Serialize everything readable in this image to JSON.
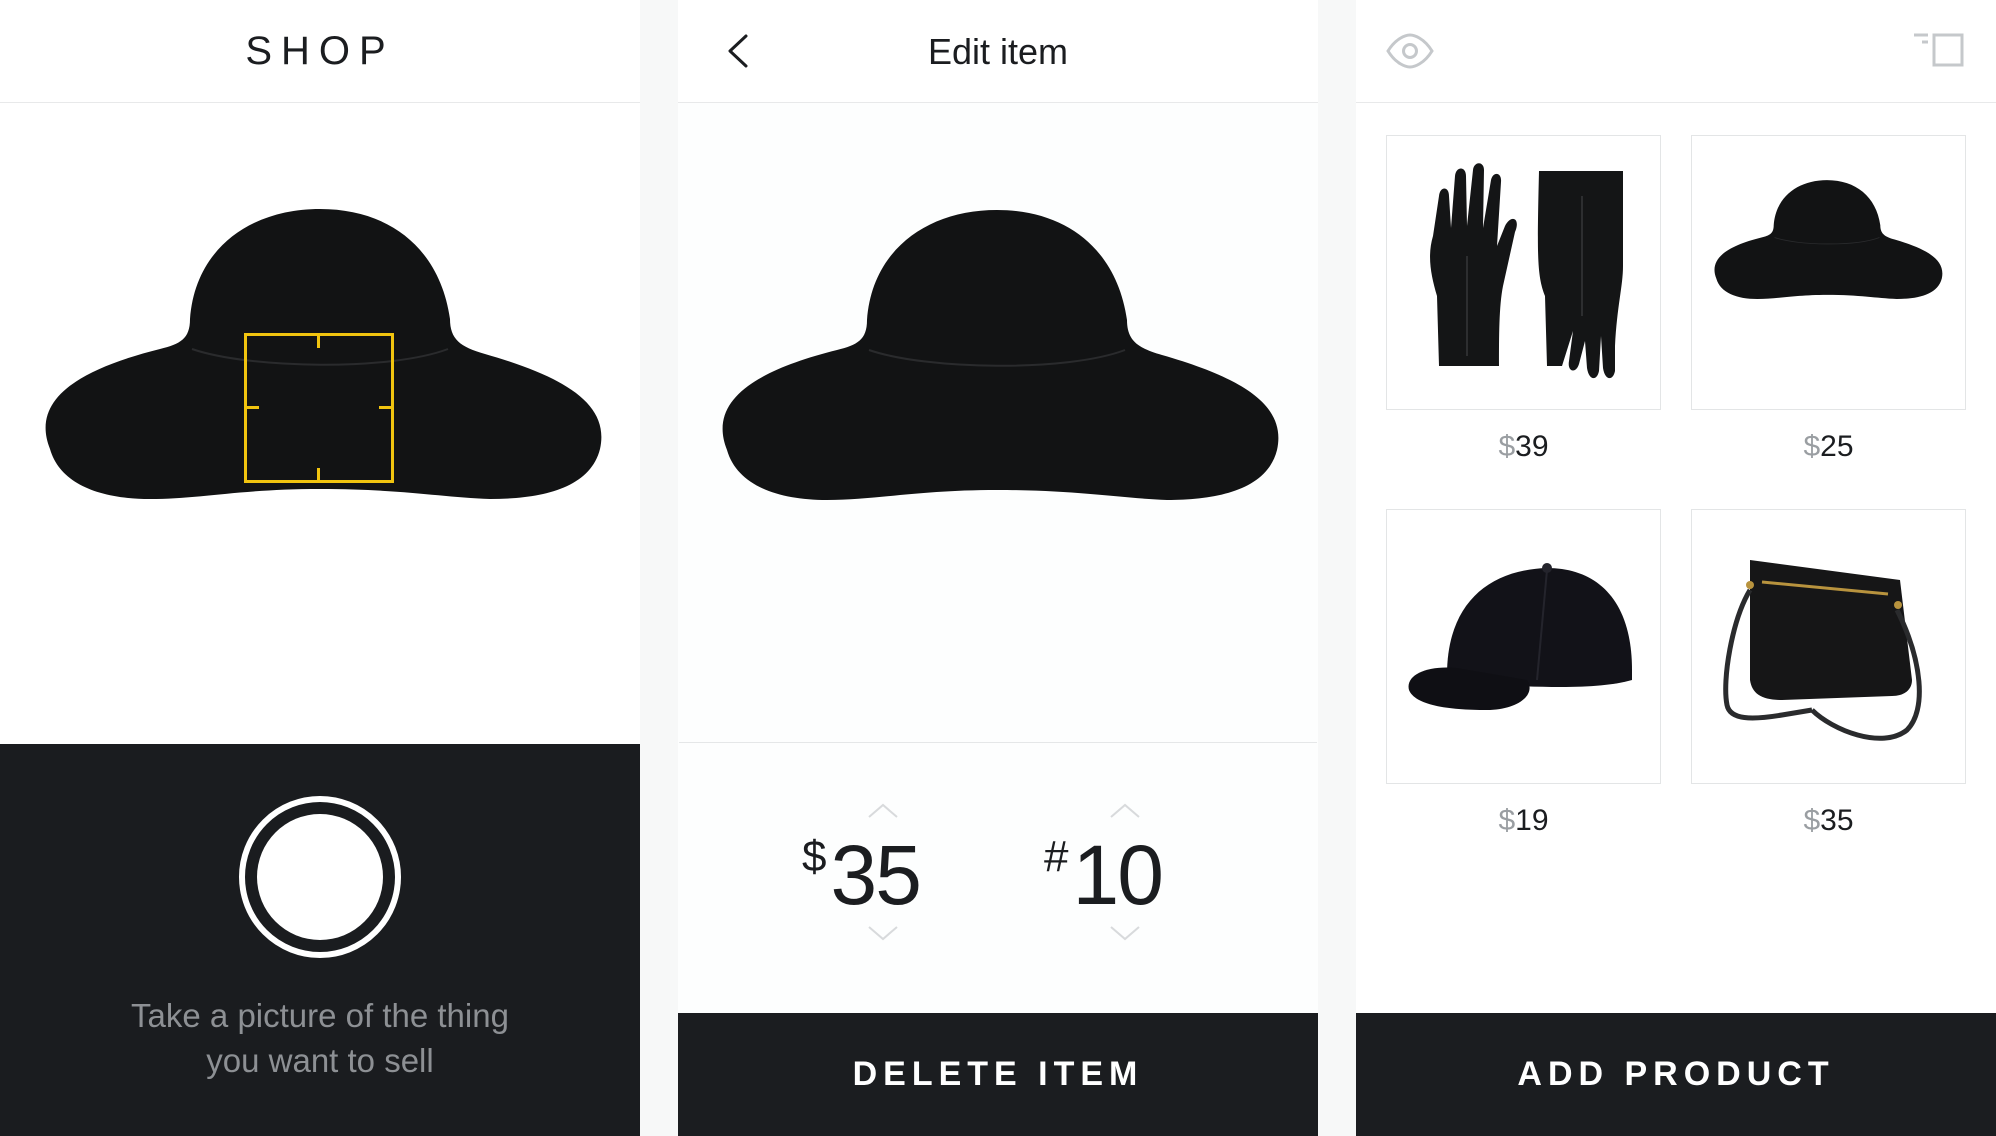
{
  "screen_shop": {
    "title": "SHOP",
    "hint_line1": "Take a picture of the thing",
    "hint_line2": "you want to sell",
    "focus_color": "#f1c40f"
  },
  "screen_edit": {
    "title": "Edit item",
    "price": {
      "prefix": "$",
      "value": "35"
    },
    "quantity": {
      "prefix": "#",
      "value": "10"
    },
    "delete_label": "DELETE ITEM",
    "back_icon": "chevron-left-icon"
  },
  "screen_products": {
    "preview_icon": "eye-icon",
    "layout_icon": "square-toggle-icon",
    "products": [
      {
        "name": "gloves",
        "currency": "$",
        "price": "39"
      },
      {
        "name": "floppy-hat",
        "currency": "$",
        "price": "25"
      },
      {
        "name": "baseball-cap",
        "currency": "$",
        "price": "19"
      },
      {
        "name": "crossbody-bag",
        "currency": "$",
        "price": "35"
      }
    ],
    "add_label": "ADD PRODUCT"
  },
  "colors": {
    "dark": "#1b1d20",
    "accent": "#f1c40f",
    "muted_text": "#8d9094"
  }
}
